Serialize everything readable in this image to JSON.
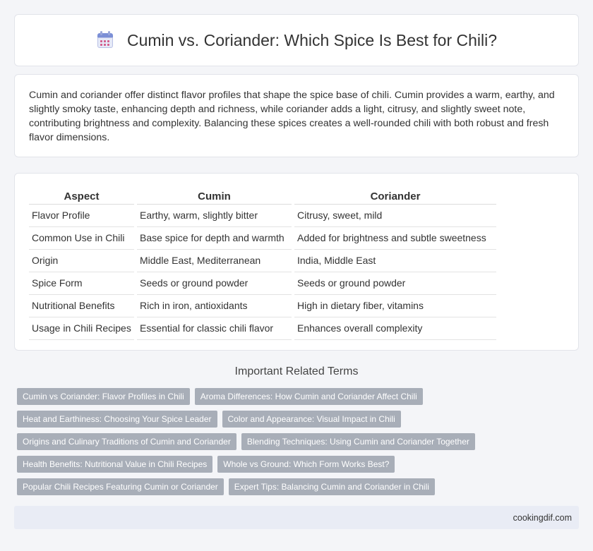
{
  "header": {
    "title": "Cumin vs. Coriander: Which Spice Is Best for Chili?",
    "icon": "calendar-icon"
  },
  "intro": {
    "text": "Cumin and coriander offer distinct flavor profiles that shape the spice base of chili. Cumin provides a warm, earthy, and slightly smoky taste, enhancing depth and richness, while coriander adds a light, citrusy, and slightly sweet note, contributing brightness and complexity. Balancing these spices creates a well-rounded chili with both robust and fresh flavor dimensions."
  },
  "table": {
    "headers": [
      "Aspect",
      "Cumin",
      "Coriander"
    ],
    "rows": [
      [
        "Flavor Profile",
        "Earthy, warm, slightly bitter",
        "Citrusy, sweet, mild"
      ],
      [
        "Common Use in Chili",
        "Base spice for depth and warmth",
        "Added for brightness and subtle sweetness"
      ],
      [
        "Origin",
        "Middle East, Mediterranean",
        "India, Middle East"
      ],
      [
        "Spice Form",
        "Seeds or ground powder",
        "Seeds or ground powder"
      ],
      [
        "Nutritional Benefits",
        "Rich in iron, antioxidants",
        "High in dietary fiber, vitamins"
      ],
      [
        "Usage in Chili Recipes",
        "Essential for classic chili flavor",
        "Enhances overall complexity"
      ]
    ]
  },
  "related": {
    "title": "Important Related Terms",
    "rows": [
      [
        "Cumin vs Coriander: Flavor Profiles in Chili",
        "Aroma Differences: How Cumin and Coriander Affect Chili"
      ],
      [
        "Heat and Earthiness: Choosing Your Spice Leader",
        "Color and Appearance: Visual Impact in Chili"
      ],
      [
        "Origins and Culinary Traditions of Cumin and Coriander",
        "Blending Techniques: Using Cumin and Coriander Together"
      ],
      [
        "Health Benefits: Nutritional Value in Chili Recipes",
        "Whole vs Ground: Which Form Works Best?"
      ],
      [
        "Popular Chili Recipes Featuring Cumin or Coriander",
        "Expert Tips: Balancing Cumin and Coriander in Chili"
      ]
    ]
  },
  "footer": {
    "site": "cookingdif.com"
  }
}
